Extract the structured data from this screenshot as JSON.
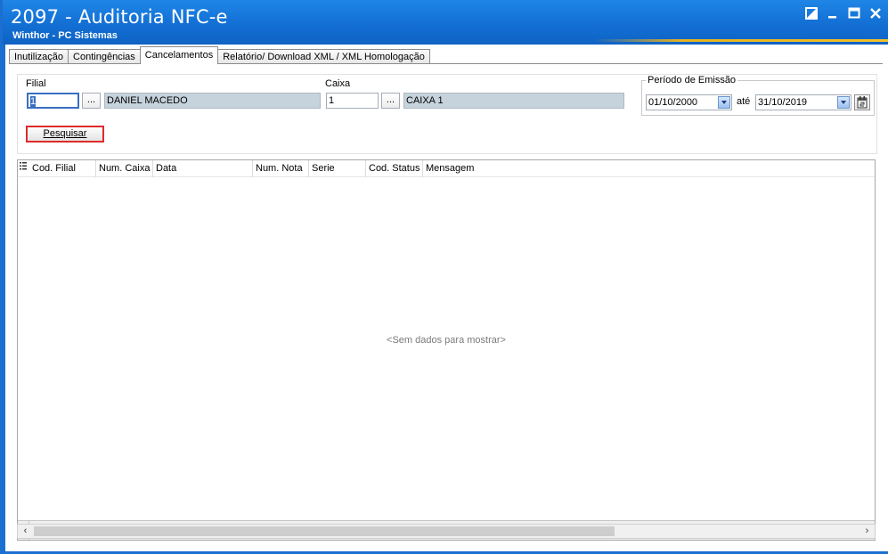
{
  "window": {
    "title": "2097 - Auditoria NFC-e",
    "subtitle": "Winthor - PC Sistemas"
  },
  "tabs": [
    {
      "label": "Inutilização",
      "active": false
    },
    {
      "label": "Contingências",
      "active": false
    },
    {
      "label": "Cancelamentos",
      "active": true
    },
    {
      "label": "Relatório/ Download XML / XML Homologação",
      "active": false
    }
  ],
  "filter": {
    "filial_label": "Filial",
    "filial_value": "1",
    "filial_name": "DANIEL MACEDO",
    "caixa_label": "Caixa",
    "caixa_value": "1",
    "caixa_name": "CAIXA 1",
    "ellipsis": "...",
    "periodo_label": "Período de Emissão",
    "date_from": "01/10/2000",
    "ate_label": "até",
    "date_to": "31/10/2019",
    "search_label": "Pesquisar"
  },
  "grid": {
    "columns": [
      "Cod. Filial",
      "Num. Caixa",
      "Data",
      "Num. Nota",
      "Serie",
      "Cod. Status",
      "Mensagem"
    ],
    "empty_text": "<Sem dados para mostrar>"
  },
  "colors": {
    "title_bar": "#136fd4",
    "highlight_border": "#e02a2a",
    "readonly_field": "#c6d3dd"
  }
}
